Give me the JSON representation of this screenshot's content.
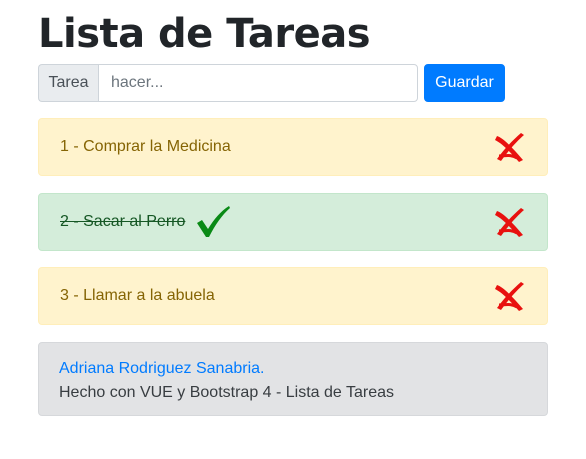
{
  "page": {
    "title": "Lista de Tareas"
  },
  "form": {
    "prefix_label": "Tarea",
    "input_placeholder": "hacer...",
    "input_value": "",
    "save_label": "Guardar"
  },
  "tasks": [
    {
      "text": "1 - Comprar la Medicina",
      "status": "pending",
      "delete_icon": "red-x-icon"
    },
    {
      "text": "2 - Sacar al Perro",
      "status": "done",
      "status_icon": "green-checkmark-icon",
      "delete_icon": "red-x-icon"
    },
    {
      "text": "3 - Llamar a la abuela",
      "status": "pending",
      "delete_icon": "red-x-icon"
    }
  ],
  "footer": {
    "author": "Adriana Rodriguez Sanabria.",
    "credits": "Hecho con VUE y Bootstrap 4 - Lista de Tareas"
  },
  "colors": {
    "primary": "#007bff",
    "pending_bg": "#fff3cd",
    "done_bg": "#d4edda",
    "footer_bg": "#e2e3e5",
    "delete_red": "#e8110f",
    "check_green": "#0a8a16"
  }
}
